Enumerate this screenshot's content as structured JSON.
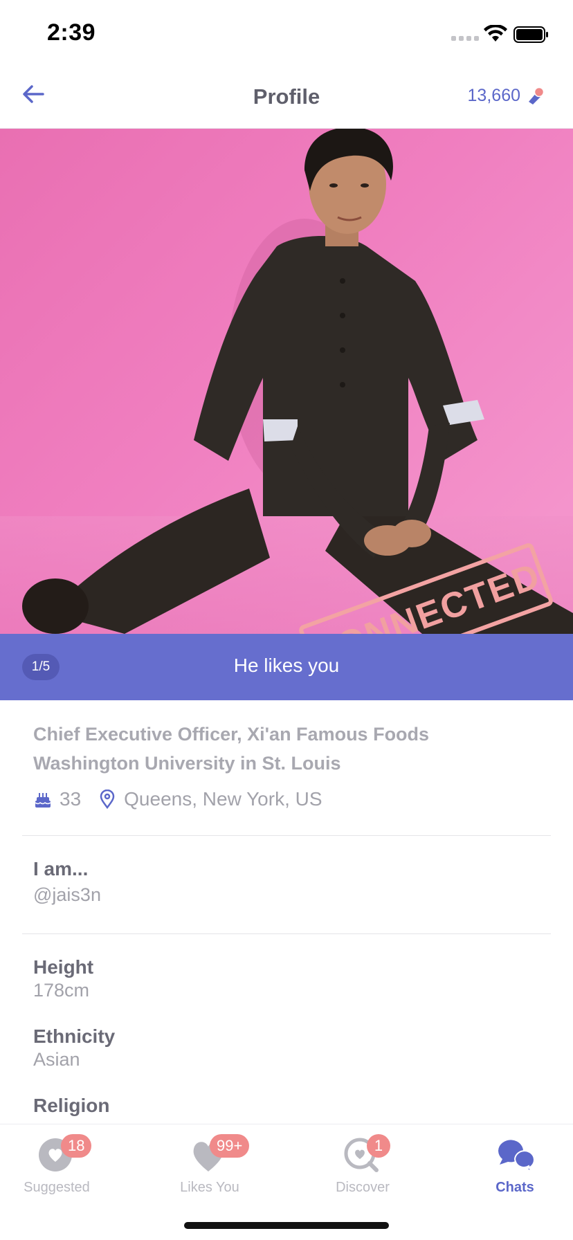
{
  "status_bar": {
    "time": "2:39"
  },
  "nav": {
    "title": "Profile",
    "coins": "13,660"
  },
  "photo": {
    "stamp_text": "CONNECTED",
    "counter": "1/5"
  },
  "banner": {
    "text": "He likes you"
  },
  "profile": {
    "job": "Chief Executive Officer, Xi'an Famous Foods",
    "school": "Washington University in St. Louis",
    "age": "33",
    "location": "Queens, New York, US"
  },
  "fields": [
    {
      "label": "I am...",
      "value": "@jais3n"
    },
    {
      "label": "Height",
      "value": "178cm"
    },
    {
      "label": "Ethnicity",
      "value": "Asian"
    },
    {
      "label": "Religion",
      "value": ""
    }
  ],
  "tabs": [
    {
      "label": "Suggested",
      "badge": "18",
      "icon": "heart-circle-icon"
    },
    {
      "label": "Likes You",
      "badge": "99+",
      "icon": "heart-icon"
    },
    {
      "label": "Discover",
      "badge": "1",
      "icon": "search-heart-icon"
    },
    {
      "label": "Chats",
      "badge": "",
      "icon": "chat-bubbles-icon"
    }
  ],
  "colors": {
    "accent": "#5b67c9",
    "banner": "#6068cc",
    "badge": "#f08a8a",
    "photo_bg": "#ee78bb"
  }
}
